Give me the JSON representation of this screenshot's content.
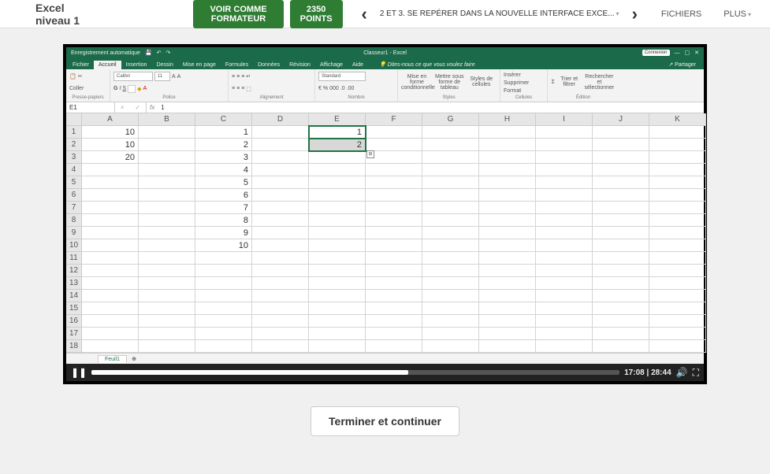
{
  "topbar": {
    "course_title": "Excel niveau 1",
    "view_as_trainer": "VOIR COMME FORMATEUR",
    "points": "2350 POINTS",
    "lesson_title": "2 ET 3. SE REPÉRER DANS LA NOUVELLE INTERFACE EXCE...",
    "files": "FICHIERS",
    "more": "PLUS"
  },
  "excel": {
    "autosave": "Enregistrement automatique",
    "doc_title": "Classeur1 - Excel",
    "connection": "Connexion",
    "share": "Partager",
    "tell_me": "Dites-nous ce que vous voulez faire",
    "tabs": [
      "Fichier",
      "Accueil",
      "Insertion",
      "Dessin",
      "Mise en page",
      "Formules",
      "Données",
      "Révision",
      "Affichage",
      "Aide"
    ],
    "active_tab": 1,
    "groups": {
      "clipboard": "Presse-papiers",
      "paste": "Coller",
      "font": "Police",
      "font_name": "Calibri",
      "font_size": "11",
      "alignment": "Alignement",
      "number": "Nombre",
      "number_format": "Standard",
      "styles": "Styles",
      "style1": "Mise en forme conditionnelle",
      "style2": "Mettre sous forme de tableau",
      "style3": "Styles de cellules",
      "cells": "Cellules",
      "insert": "Insérer",
      "delete": "Supprimer",
      "format": "Format",
      "editing": "Édition",
      "sort": "Trier et filtrer",
      "find": "Rechercher et sélectionner"
    },
    "namebox": "E1",
    "formula": "1",
    "columns": [
      "A",
      "B",
      "C",
      "D",
      "E",
      "F",
      "G",
      "H",
      "I",
      "J",
      "K"
    ],
    "rows": 18,
    "data": {
      "A1": "10",
      "A2": "10",
      "A3": "20",
      "C1": "1",
      "C2": "2",
      "C3": "3",
      "C4": "4",
      "C5": "5",
      "C6": "6",
      "C7": "7",
      "C8": "8",
      "C9": "9",
      "C10": "10",
      "E1": "1",
      "E2": "2"
    },
    "selection": [
      "E1",
      "E2"
    ],
    "sheet": "Feuil1"
  },
  "video": {
    "current": "17:08",
    "total": "28:44"
  },
  "finish": "Terminer et continuer"
}
